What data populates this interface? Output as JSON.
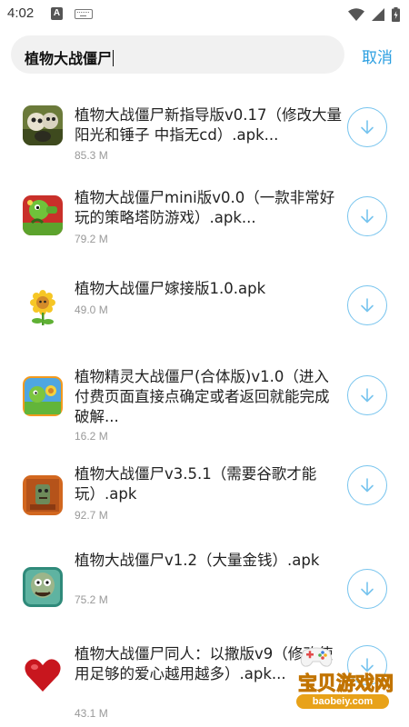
{
  "status_bar": {
    "time": "4:02",
    "notification_letter": "A",
    "icons": [
      "keyboard-icon",
      "wifi-icon",
      "signal-icon",
      "battery-icon"
    ]
  },
  "search": {
    "query": "植物大战僵尸",
    "cancel_label": "取消"
  },
  "results": [
    {
      "title": "植物大战僵尸新指导版v0.17（修改大量阳光和锤子 中指无cd）.apk...",
      "size": "85.3 M",
      "icon": "zombie-game-icon"
    },
    {
      "title": "植物大战僵尸mini版v0.0（一款非常好玩的策略塔防游戏）.apk...",
      "size": "79.2 M",
      "icon": "peashooter-game-icon"
    },
    {
      "title": "植物大战僵尸嫁接版1.0.apk",
      "size": "49.0 M",
      "icon": "sunflower-icon"
    },
    {
      "title": "植物精灵大战僵尸(合体版)v1.0（进入付费页面直接点确定或者返回就能完成破解...",
      "size": "16.2 M",
      "icon": "plant-sprite-game-icon"
    },
    {
      "title": "植物大战僵尸v3.5.1（需要谷歌才能玩）.apk",
      "size": "92.7 M",
      "icon": "zombie-poster-icon"
    },
    {
      "title": "植物大战僵尸v1.2（大量金钱）.apk",
      "size": "75.2 M",
      "icon": "zombie-head-icon"
    },
    {
      "title": "植物大战僵尸同人：以撒版v9（修改使用足够的爱心越用越多）.apk...",
      "size": "43.1 M",
      "icon": "heart-icon"
    }
  ],
  "watermark": {
    "name": "宝贝游戏网",
    "url": "baobeiy.com"
  },
  "colors": {
    "accent": "#2a9ee0",
    "download_ring": "#77c4ee",
    "search_bg": "#f1f1f1",
    "size_text": "#999999"
  }
}
